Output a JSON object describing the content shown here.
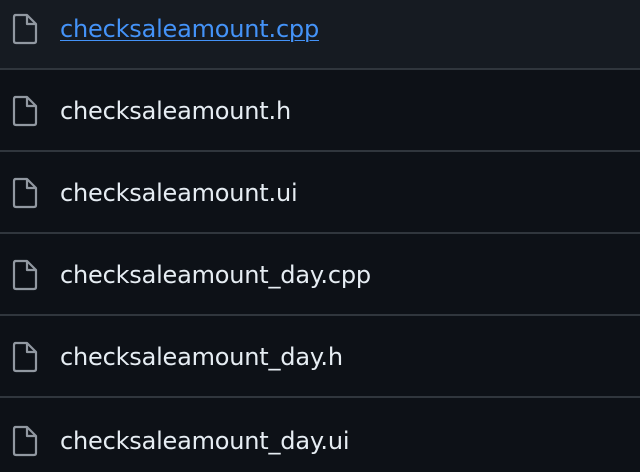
{
  "files": [
    {
      "name": "checksaleamount.cpp",
      "icon": "file-icon"
    },
    {
      "name": "checksaleamount.h",
      "icon": "file-icon"
    },
    {
      "name": "checksaleamount.ui",
      "icon": "file-icon"
    },
    {
      "name": "checksaleamount_day.cpp",
      "icon": "file-icon"
    },
    {
      "name": "checksaleamount_day.h",
      "icon": "file-icon"
    },
    {
      "name": "checksaleamount_day.ui",
      "icon": "file-icon"
    }
  ],
  "colors": {
    "background": "#0d1117",
    "hover_background": "#161b22",
    "divider": "#30363d",
    "text": "#e6edf3",
    "link": "#4493f8",
    "icon": "#9198a1"
  }
}
